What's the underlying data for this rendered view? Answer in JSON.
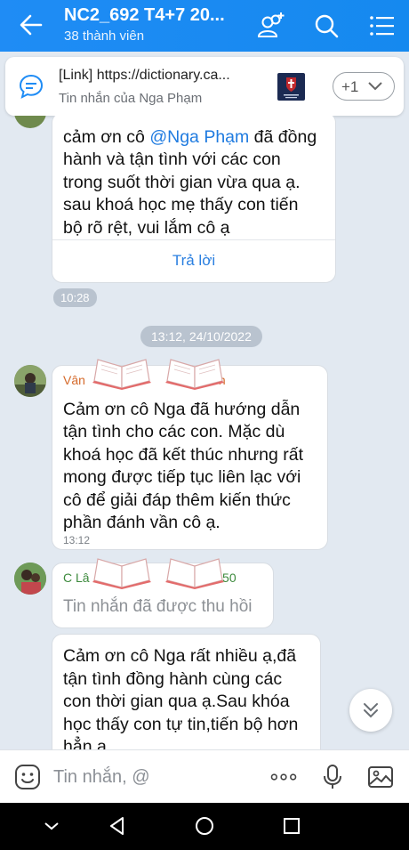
{
  "header": {
    "title": "NC2_692 T4+7 20...",
    "members": "38 thành viên"
  },
  "pinned": {
    "title": "[Link] https://dictionary.ca...",
    "subtitle": "Tin nhắn của Nga Phạm",
    "more_count": "+1"
  },
  "messages": {
    "first": {
      "pre": "cảm ơn cô ",
      "mention": "@Nga Phạm",
      "line1_rest": " đã đồng",
      "line2": "hành và tận tình với các con",
      "line3": "trong suốt thời gian vừa qua ạ.",
      "line4": "sau khoá học mẹ thấy con tiến",
      "line5": "bộ rõ rệt, vui lắm cô ạ",
      "reply": "Trả lời",
      "time": "10:28"
    },
    "date_separator": "13:12, 24/10/2022",
    "second": {
      "sender_start": "Vân",
      "sender_end": "h",
      "lines": [
        "Cảm ơn cô Nga đã hướng dẫn",
        "tận tình cho các con. Mặc dù",
        "khoá học đã kết thúc nhưng rất",
        "mong được tiếp tục liên lạc với",
        "cô để giải đáp thêm kiến thức",
        "phần đánh vần cô ạ."
      ],
      "time": "13:12"
    },
    "third": {
      "sender_start": "C Lâ",
      "sender_end": "ế 550",
      "recalled": "Tin nhắn đã được thu hồi",
      "lines": [
        "Cảm ơn cô Nga rất nhiều ạ,đã",
        "tận tình đồng hành cùng các",
        "con thời gian qua ạ.Sau khóa",
        "học thấy con tự tin,tiến bộ hơn",
        "hẳn ạ."
      ]
    }
  },
  "input": {
    "placeholder": "Tin nhắn, @"
  },
  "colors": {
    "header": "#1f8cf5",
    "background": "#e2e9f1",
    "mention": "#1f7be0"
  }
}
